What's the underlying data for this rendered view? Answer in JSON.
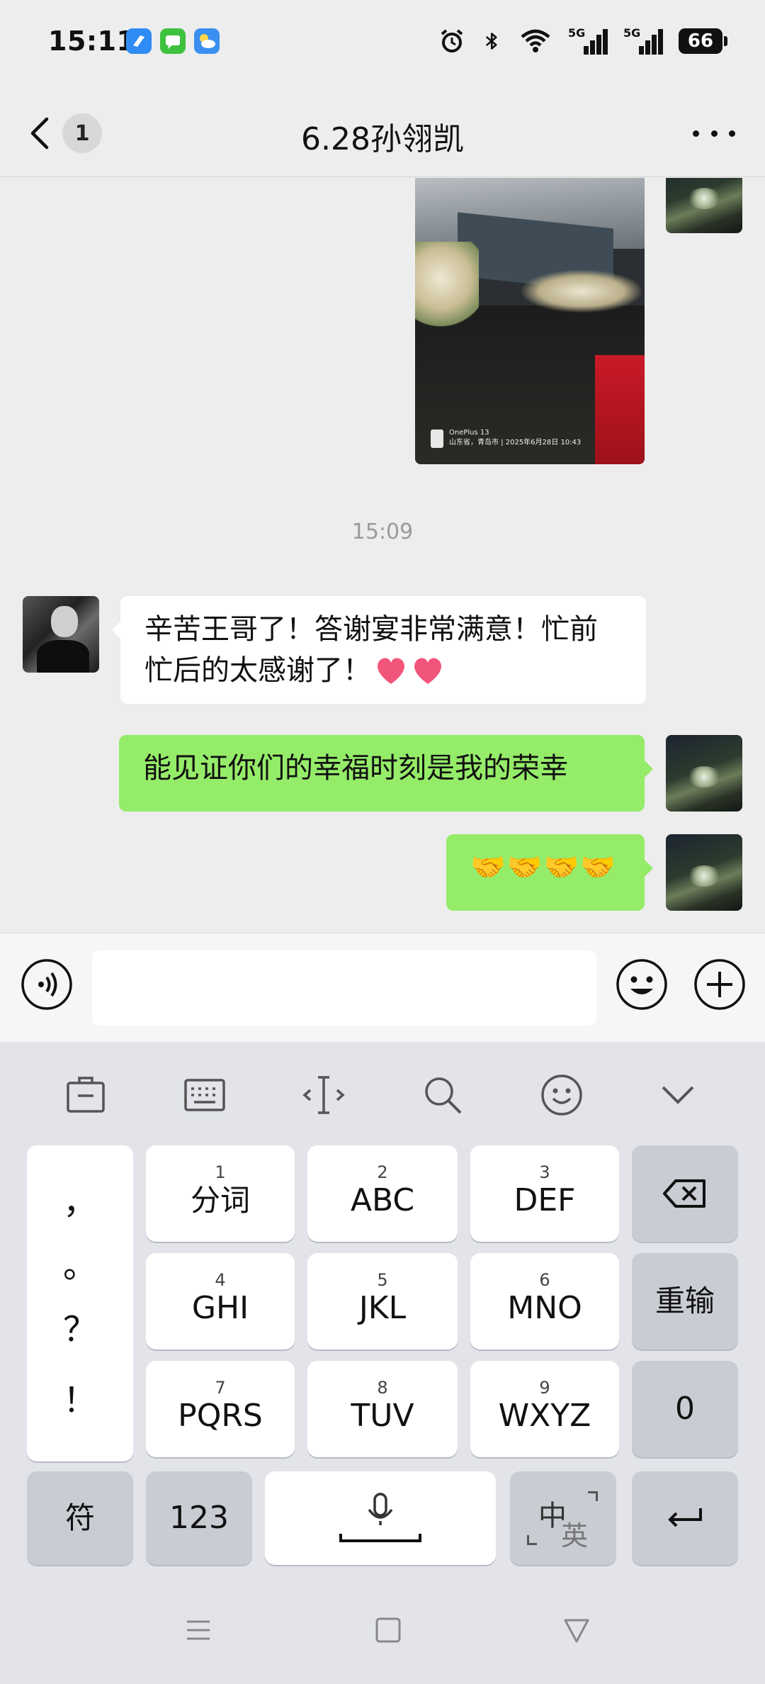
{
  "status_bar": {
    "time": "15:11",
    "network_1": "5G",
    "network_2": "5G",
    "battery_level": "66",
    "icons": [
      "browser-icon",
      "messages-icon",
      "weather-icon",
      "alarm-icon",
      "bluetooth-icon",
      "wifi-icon"
    ]
  },
  "header": {
    "unread_count": "1",
    "title": "6.28孙翎凯"
  },
  "chat": {
    "photo_watermark": {
      "device": "OnePlus 13",
      "info": "山东省，青岛市 | 2025年6月28日 10:43"
    },
    "time_divider": "15:09",
    "messages": [
      {
        "direction": "in",
        "text": "辛苦王哥了！答谢宴非常满意！忙前忙后的太感谢了！"
      },
      {
        "direction": "out",
        "text": "能见证你们的幸福时刻是我的荣幸"
      },
      {
        "direction": "out",
        "text": "🤝🤝🤝🤝"
      }
    ]
  },
  "keyboard": {
    "punctuation": [
      "，",
      "。",
      "？",
      "！"
    ],
    "keys": [
      {
        "num": "1",
        "label": "分词"
      },
      {
        "num": "2",
        "label": "ABC"
      },
      {
        "num": "3",
        "label": "DEF"
      },
      {
        "num": "4",
        "label": "GHI"
      },
      {
        "num": "5",
        "label": "JKL"
      },
      {
        "num": "6",
        "label": "MNO"
      },
      {
        "num": "7",
        "label": "PQRS"
      },
      {
        "num": "8",
        "label": "TUV"
      },
      {
        "num": "9",
        "label": "WXYZ"
      }
    ],
    "reinput_label": "重输",
    "zero_label": "0",
    "symbols_label": "符",
    "numbers_label": "123",
    "lang_zh": "中",
    "lang_en": "英"
  },
  "colors": {
    "outgoing_bubble": "#95ec69",
    "incoming_bubble": "#ffffff",
    "chat_background": "#ededed",
    "keyboard_background": "#e2e4ea"
  }
}
